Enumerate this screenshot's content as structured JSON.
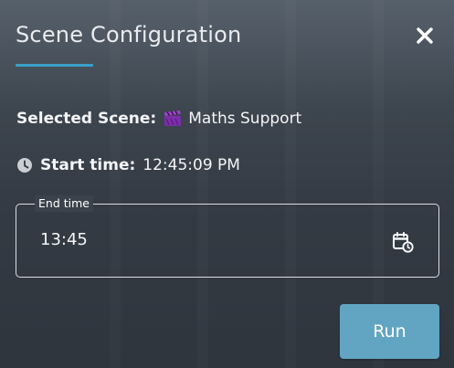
{
  "dialog": {
    "title": "Scene Configuration",
    "close_icon": "close-icon"
  },
  "scene": {
    "label": "Selected Scene:",
    "icon": "clapperboard-icon",
    "icon_color": "#7b2fa8",
    "name": "Maths Support"
  },
  "start": {
    "icon": "clock-icon",
    "label": "Start time:",
    "value": "12:45:09 PM"
  },
  "end_time": {
    "legend": "End time",
    "value": "13:45",
    "icon": "calendar-clock-icon"
  },
  "actions": {
    "run_label": "Run"
  },
  "colors": {
    "accent": "#3aa0c8",
    "run_button": "#62a5c3"
  }
}
